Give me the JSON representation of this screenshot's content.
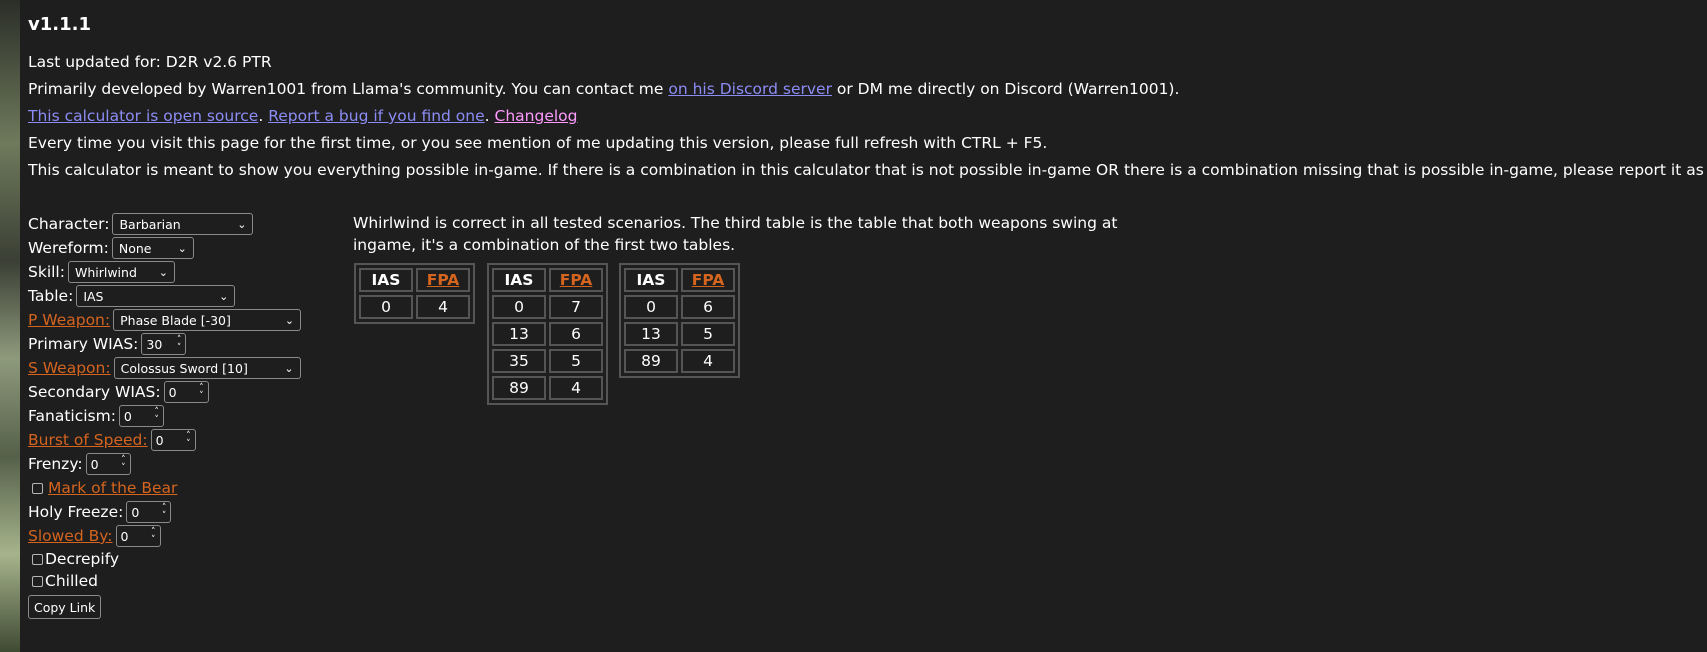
{
  "version": "v1.1.1",
  "info": {
    "last_updated": "Last updated for: D2R v2.6 PTR",
    "dev_text_1": "Primarily developed by Warren1001 from Llama's community. You can contact me ",
    "dev_link": "on his Discord server",
    "dev_text_2": " or DM me directly on Discord (Warren1001).",
    "open_source_link": "This calculator is open source",
    "sep1": ". ",
    "bug_link": "Report a bug if you find one",
    "sep2": ". ",
    "changelog_link": "Changelog",
    "refresh_note": "Every time you visit this page for the first time, or you see mention of me updating this version, please full refresh with CTRL + F5.",
    "purpose_note": "This calculator is meant to show you everything possible in-game. If there is a combination in this calculator that is not possible in-game OR there is a combination missing that is possible in-game, please report it as a bug."
  },
  "form": {
    "character": {
      "label": "Character:",
      "value": "Barbarian"
    },
    "wereform": {
      "label": "Wereform:",
      "value": "None"
    },
    "skill": {
      "label": "Skill:",
      "value": "Whirlwind"
    },
    "table": {
      "label": "Table:",
      "value": "IAS"
    },
    "p_weapon": {
      "label": "P Weapon:",
      "value": "Phase Blade [-30]"
    },
    "primary_wias": {
      "label": "Primary WIAS:",
      "value": "30"
    },
    "s_weapon": {
      "label": "S Weapon:",
      "value": "Colossus Sword [10]"
    },
    "secondary_wias": {
      "label": "Secondary WIAS:",
      "value": "0"
    },
    "fanaticism": {
      "label": "Fanaticism:",
      "value": "0"
    },
    "burst_of_speed": {
      "label": "Burst of Speed:",
      "value": "0"
    },
    "frenzy": {
      "label": "Frenzy:",
      "value": "0"
    },
    "mark_of_the_bear": {
      "label": "Mark of the Bear"
    },
    "holy_freeze": {
      "label": "Holy Freeze:",
      "value": "0"
    },
    "slowed_by": {
      "label": "Slowed By:",
      "value": "0"
    },
    "decrepify": {
      "label": "Decrepify"
    },
    "chilled": {
      "label": "Chilled"
    },
    "copy_link": "Copy Link"
  },
  "note": "Whirlwind is correct in all tested scenarios. The third table is the table that both weapons swing at ingame, it's a combination of the first two tables.",
  "tables": [
    {
      "headers": [
        "IAS",
        "FPA"
      ],
      "rows": [
        [
          "0",
          "4"
        ]
      ]
    },
    {
      "headers": [
        "IAS",
        "FPA"
      ],
      "rows": [
        [
          "0",
          "7"
        ],
        [
          "13",
          "6"
        ],
        [
          "35",
          "5"
        ],
        [
          "89",
          "4"
        ]
      ]
    },
    {
      "headers": [
        "IAS",
        "FPA"
      ],
      "rows": [
        [
          "0",
          "6"
        ],
        [
          "13",
          "5"
        ],
        [
          "89",
          "4"
        ]
      ]
    }
  ]
}
